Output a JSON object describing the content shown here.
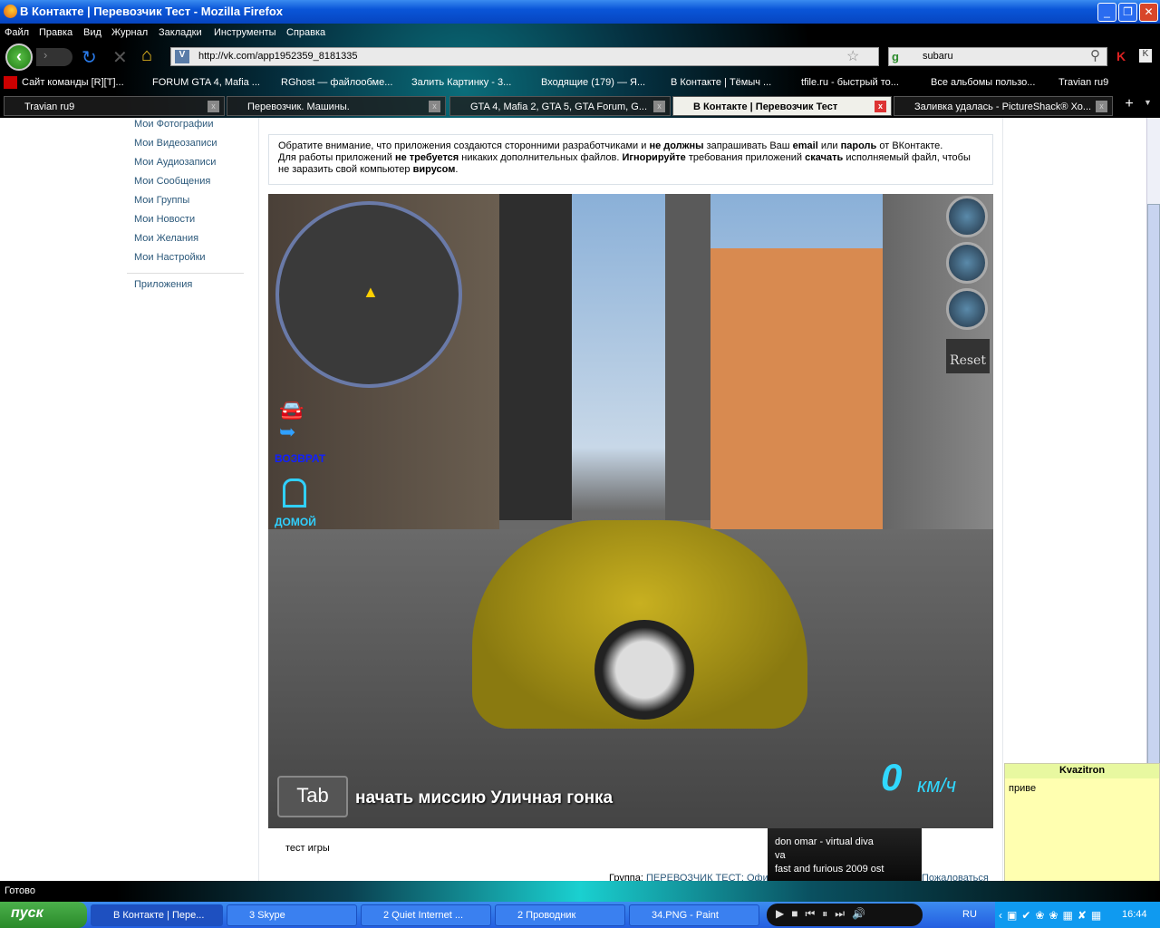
{
  "window": {
    "title": "В Контакте | Перевозчик Тест - Mozilla Firefox"
  },
  "menu": [
    "Файл",
    "Правка",
    "Вид",
    "Журнал",
    "Закладки",
    "Инструменты",
    "Справка"
  ],
  "nav": {
    "url": "http://vk.com/app1952359_8181335",
    "search": "subaru"
  },
  "bookmarks": [
    "Сайт команды [R][T]...",
    "FORUM GTA 4, Mafia ...",
    "RGhost — файлообме...",
    "Залить Картинку - 3...",
    "Входящие (179) — Я...",
    "В Контакте | Тёмыч ...",
    "tfile.ru - быстрый то...",
    "Все альбомы пользо...",
    "Travian ru9"
  ],
  "tabs": [
    {
      "label": "Travian ru9"
    },
    {
      "label": "Перевозчик. Машины."
    },
    {
      "label": "GTA 4, Mafia 2, GTA 5, GTA Forum, G..."
    },
    {
      "label": "В Контакте | Перевозчик Тест",
      "active": true
    },
    {
      "label": "Заливка удалась - PictureShack® Хо..."
    }
  ],
  "sidebar": [
    "Мои Фотографии",
    "Мои Видеозаписи",
    "Мои Аудиозаписи",
    "Мои Сообщения",
    "Мои Группы",
    "Мои Новости",
    "Мои Желания",
    "Мои Настройки"
  ],
  "sidebar_apps": "Приложения",
  "notice": {
    "p1a": "Обратите внимание, что приложения создаются сторонними разработчиками и ",
    "p1b": "не должны",
    "p1c": " запрашивать Ваш ",
    "p1d": "email",
    "p1e": " или ",
    "p1f": "пароль",
    "p1g": " от ВКонтакте.",
    "p2a": "Для работы приложений ",
    "p2b": "не требуется",
    "p2c": " никаких дополнительных файлов. ",
    "p2d": "Игнорируйте",
    "p2e": " требования приложений ",
    "p2f": "скачать",
    "p2g": " исполняемый файл, чтобы не заразить свой компьютер ",
    "p2h": "вирусом",
    "p2i": "."
  },
  "game": {
    "reset": "Reset",
    "return": "ВОЗВРАТ",
    "home": "ДОМОЙ",
    "tab_key": "Tab",
    "mission": "начать миссию Уличная гонка",
    "speed": "0",
    "speed_unit": "км/ч"
  },
  "below": {
    "caption": "тест игры",
    "group_label": "Группа: ",
    "group_link": "ПЕРЕВОЗЧИК ТЕСТ: Офиц",
    "report": "Пожаловаться"
  },
  "status": "Готово",
  "player": {
    "line1": "don omar - virtual diva",
    "line2": "va",
    "line3": "fast and furious 2009 ost",
    "progress": 0.05
  },
  "chat": {
    "name": "Kvazitron",
    "message": "приве"
  },
  "taskbar": {
    "start": "пуск",
    "items": [
      "В Контакте | Пере...",
      "3 Skype",
      "2 Quiet Internet ...",
      "2 Проводник",
      "34.PNG - Paint"
    ],
    "lang": "RU",
    "clock": "16:44"
  }
}
